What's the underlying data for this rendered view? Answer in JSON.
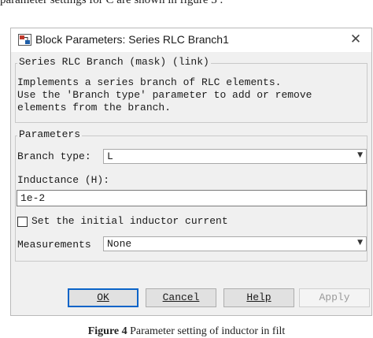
{
  "caption_top": "parameter settings for C are shown in figure 3 .",
  "window": {
    "title": "Block Parameters: Series RLC Branch1",
    "close_glyph": "✕"
  },
  "mask": {
    "legend": "Series RLC Branch (mask) (link)",
    "description": "Implements a series branch of RLC elements.\nUse the 'Branch type' parameter to add or remove\nelements from the branch."
  },
  "parameters": {
    "legend": "Parameters",
    "branch_type_label": "Branch type:",
    "branch_type_value": "L",
    "inductance_label": "Inductance (H):",
    "inductance_value": "1e-2",
    "initial_current_label": "Set the initial inductor current",
    "initial_current_checked": false,
    "measurements_label": "Measurements",
    "measurements_value": "None"
  },
  "buttons": {
    "ok": "OK",
    "cancel": "Cancel",
    "help": "Help",
    "apply": "Apply"
  },
  "caption_bottom": {
    "label": "Figure 4",
    "text": " Parameter setting of inductor in filt"
  },
  "colors": {
    "window_bg": "#f0f0f0",
    "default_button_border": "#0a64c8",
    "icon_red": "#c0392b",
    "icon_blue": "#1f5fa8"
  }
}
